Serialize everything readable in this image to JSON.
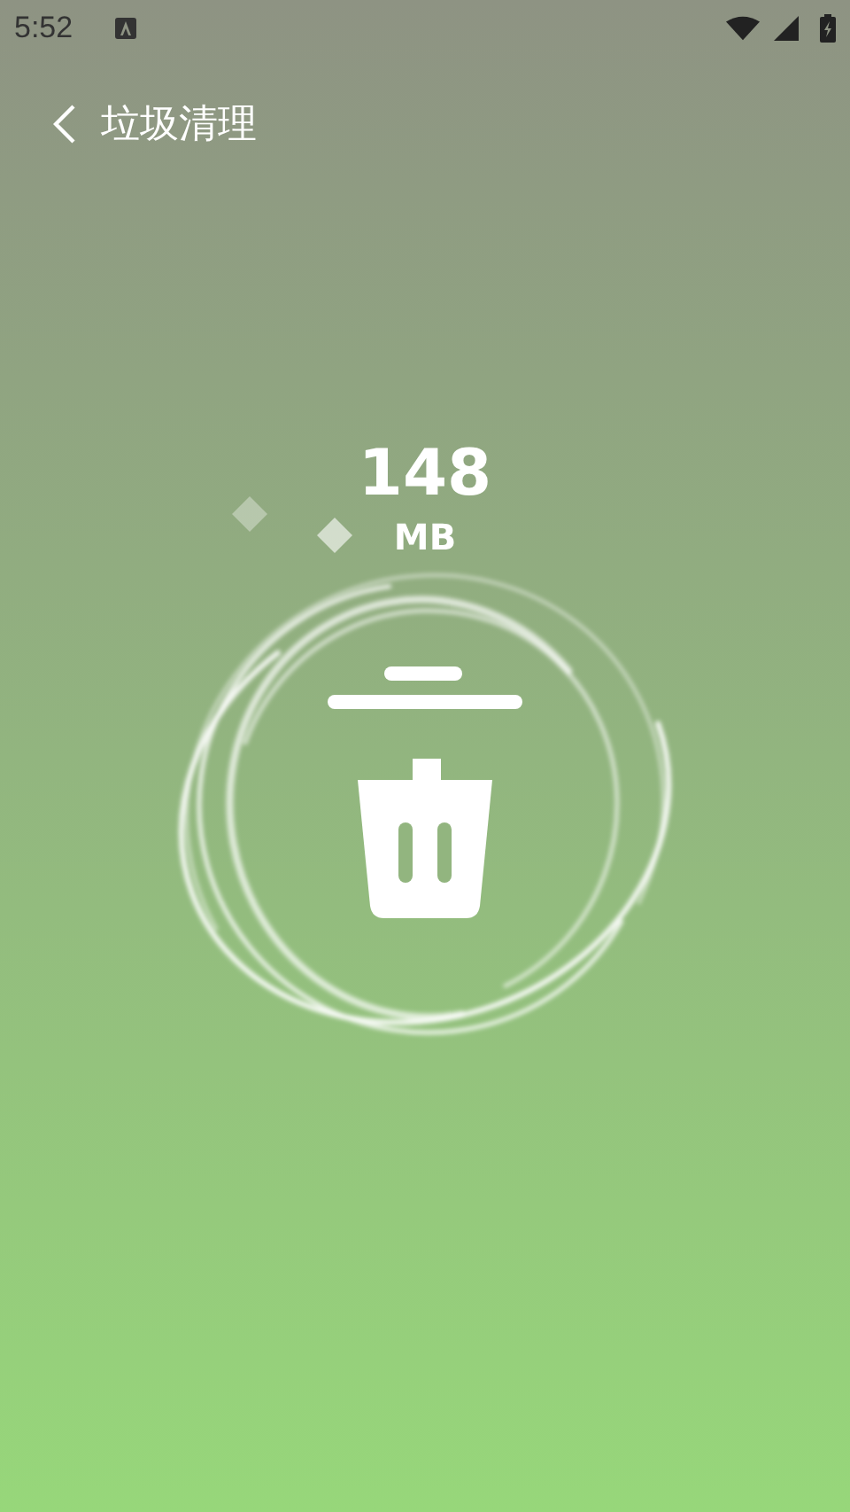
{
  "status_bar": {
    "time": "5:52"
  },
  "header": {
    "title": "垃圾清理"
  },
  "junk": {
    "amount": "148",
    "unit": "MB"
  }
}
